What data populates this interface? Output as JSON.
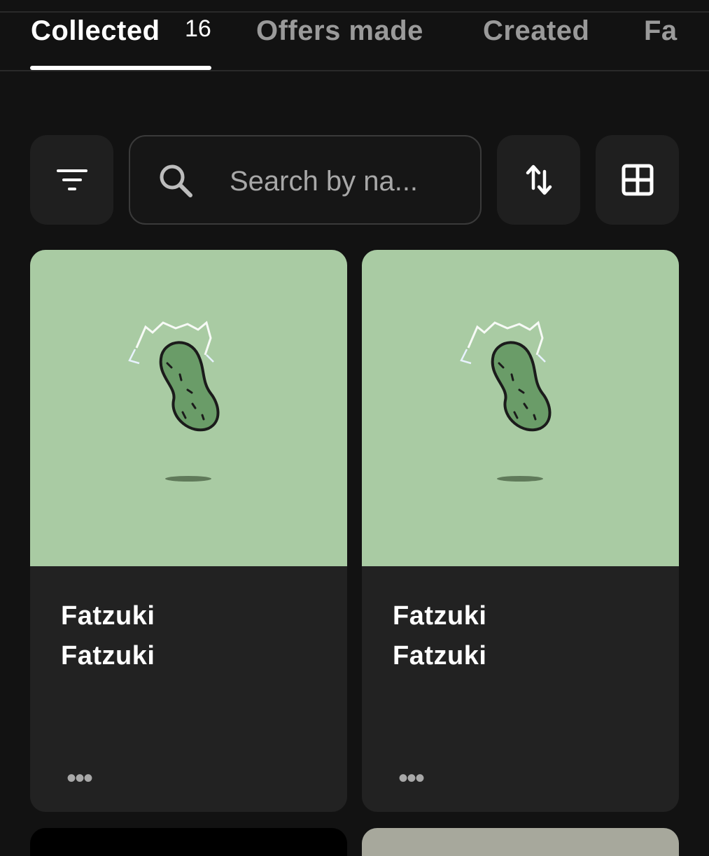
{
  "tabs": [
    {
      "label": "Collected",
      "count": "16",
      "active": true
    },
    {
      "label": "Offers made",
      "active": false
    },
    {
      "label": "Created",
      "active": false
    },
    {
      "label": "Fa",
      "active": false
    }
  ],
  "toolbar": {
    "filter_icon": "filter-icon",
    "search_placeholder": "Search by na...",
    "sort_icon": "sort-arrows-icon",
    "grid_icon": "grid-view-icon"
  },
  "cards": [
    {
      "title": "Fatzuki",
      "collection": "Fatzuki",
      "more": "•••",
      "image_bg": "#a9cba3"
    },
    {
      "title": "Fatzuki",
      "collection": "Fatzuki",
      "more": "•••",
      "image_bg": "#a9cba3"
    }
  ],
  "colors": {
    "background": "#121212",
    "card": "#222222",
    "accent": "#ffffff",
    "muted": "#9a9a9a"
  }
}
